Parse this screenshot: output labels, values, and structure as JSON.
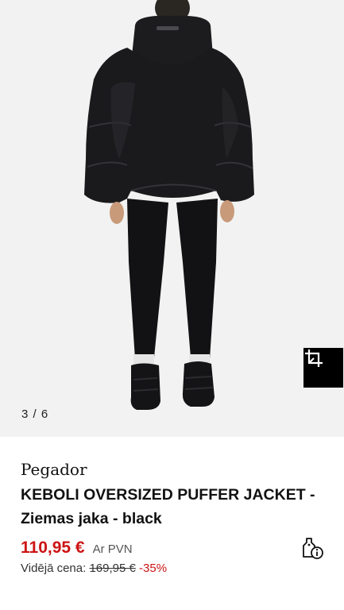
{
  "gallery": {
    "counter": "3 / 6",
    "image_alt": "Back view of model wearing black oversized puffer jacket, black leggings and black puffer boots",
    "fit_button_icon": "crop-icon"
  },
  "product": {
    "brand": "Pegador",
    "title": "KEBOLI OVERSIZED PUFFER JACKET - Ziemas jaka - black",
    "price": "110,95 €",
    "vat_label": "Ar PVN",
    "avg_price_label": "Vidējā cena:",
    "old_price": "169,95 €",
    "discount": "-35%",
    "price_info_icon": "price-tag-info-icon"
  },
  "colors": {
    "price": "#cc1414",
    "background_gallery": "#f2f2f2",
    "jacket": "#1a1a1c"
  }
}
